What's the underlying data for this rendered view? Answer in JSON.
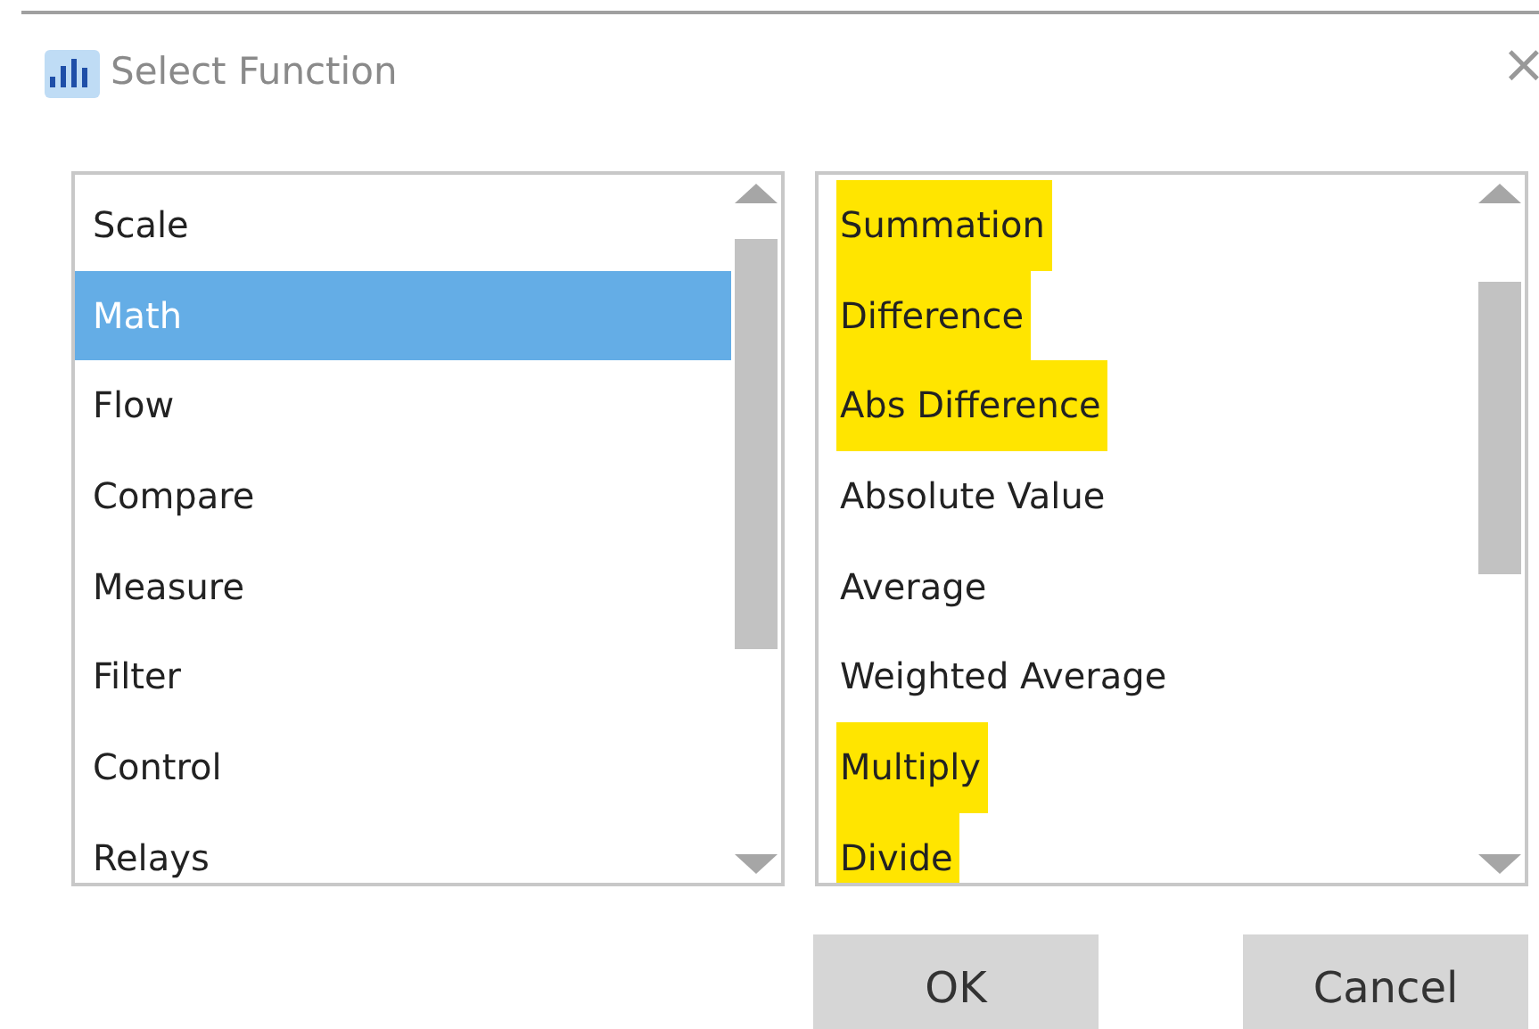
{
  "window": {
    "title": "Select Function",
    "close": "×"
  },
  "categories": [
    {
      "label": "Scale",
      "selected": false
    },
    {
      "label": "Math",
      "selected": true
    },
    {
      "label": "Flow",
      "selected": false
    },
    {
      "label": "Compare",
      "selected": false
    },
    {
      "label": "Measure",
      "selected": false
    },
    {
      "label": "Filter",
      "selected": false
    },
    {
      "label": "Control",
      "selected": false
    },
    {
      "label": "Relays",
      "selected": false
    }
  ],
  "functions": [
    {
      "label": "Summation",
      "highlighted": true
    },
    {
      "label": "Difference",
      "highlighted": true
    },
    {
      "label": "Abs Difference",
      "highlighted": true
    },
    {
      "label": "Absolute Value",
      "highlighted": false
    },
    {
      "label": "Average",
      "highlighted": false
    },
    {
      "label": "Weighted Average",
      "highlighted": false
    },
    {
      "label": "Multiply",
      "highlighted": true
    },
    {
      "label": "Divide",
      "highlighted": true
    }
  ],
  "buttons": [
    "OK",
    "Cancel"
  ]
}
